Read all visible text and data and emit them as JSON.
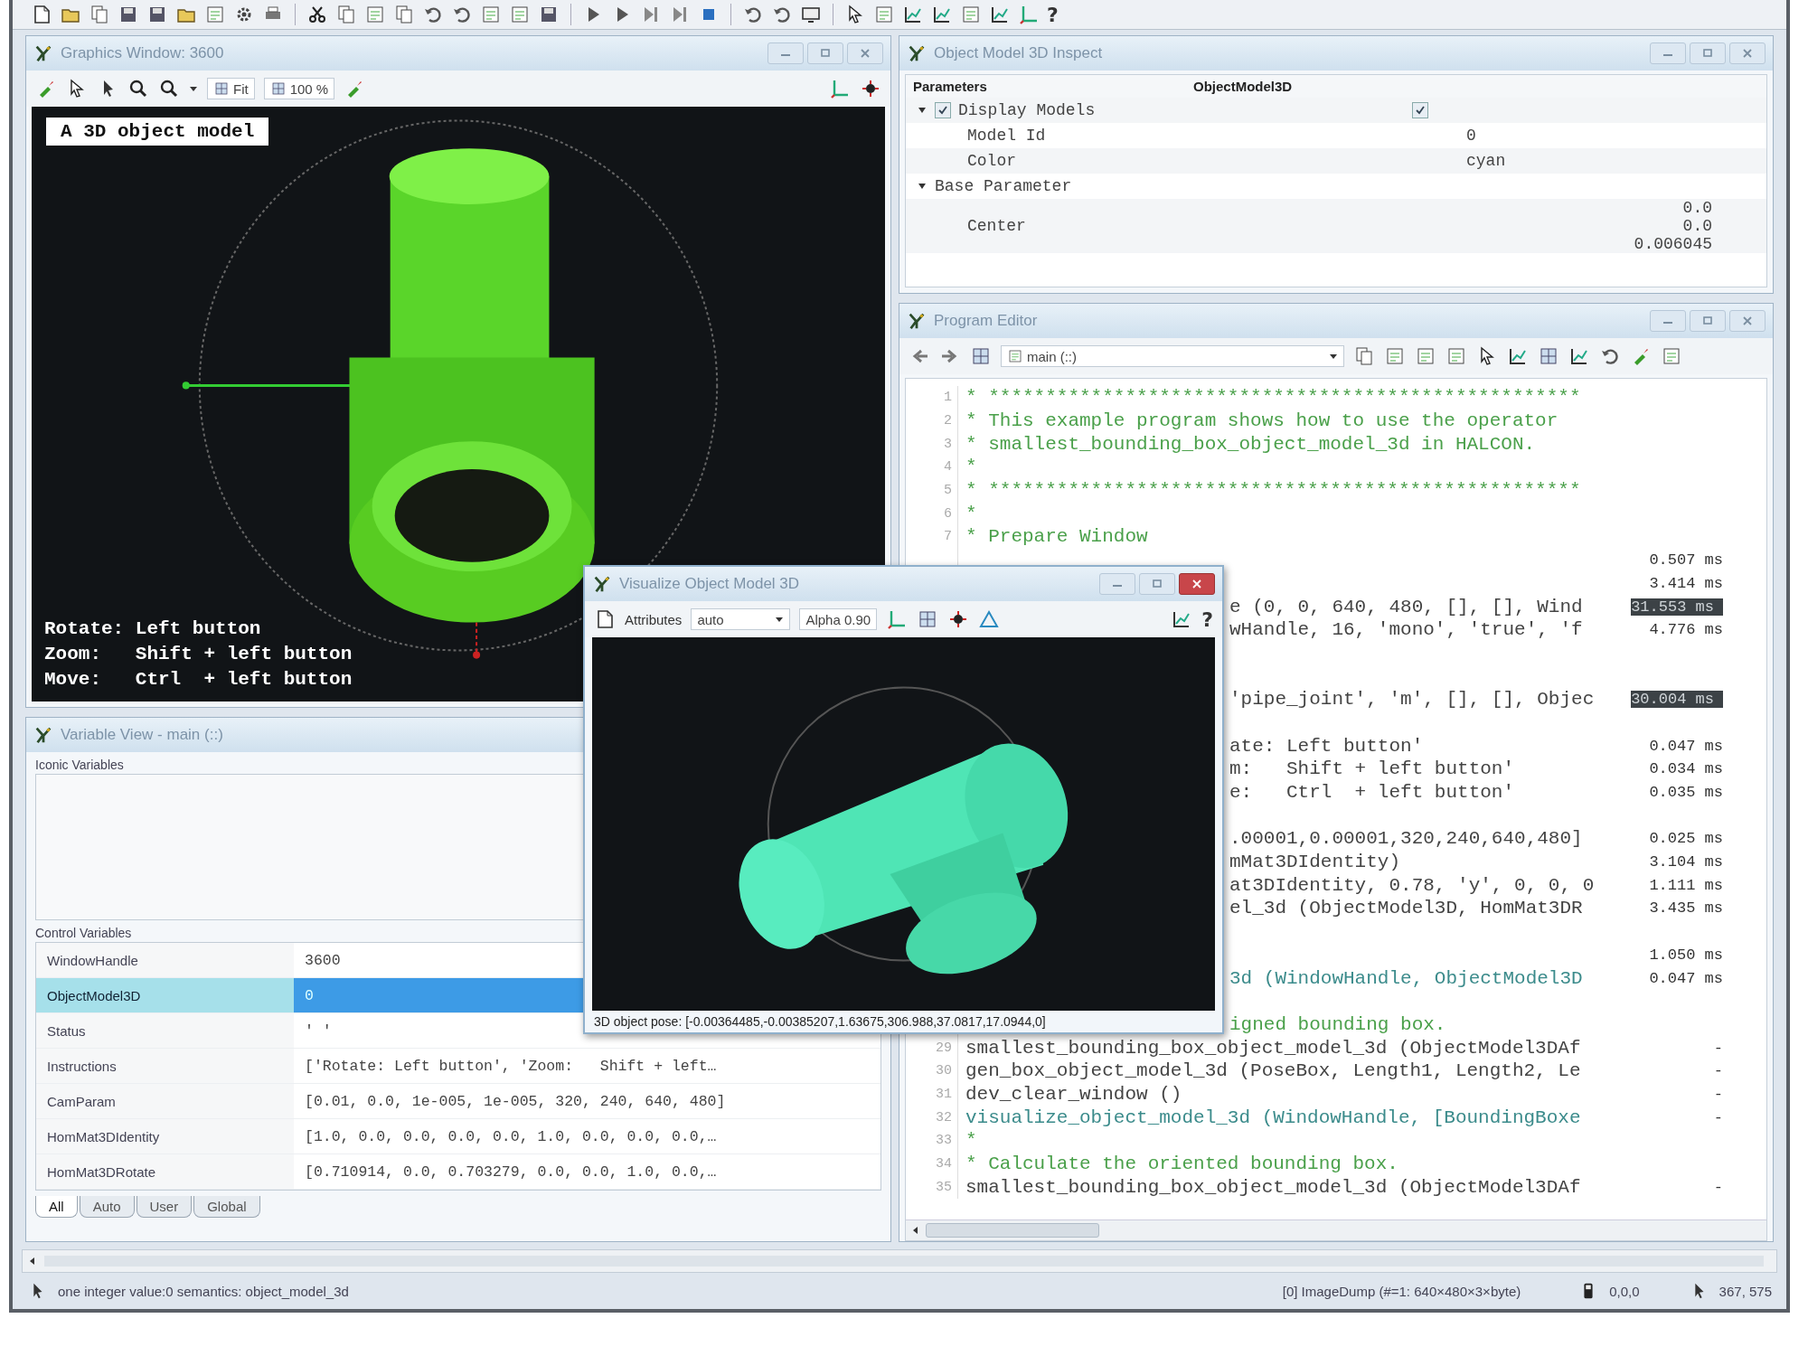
{
  "toolbar": {
    "help": "?"
  },
  "graphics_window": {
    "title": "Graphics Window: 3600",
    "zoom_fit": "Fit",
    "zoom_percent": "100 %",
    "label": "A 3D object model",
    "instructions": [
      "Rotate: Left button",
      "Zoom:   Shift + left button",
      "Move:   Ctrl  + left button"
    ]
  },
  "inspect": {
    "title": "Object Model 3D Inspect",
    "columns": [
      "Parameters",
      "ObjectModel3D"
    ],
    "tree": [
      {
        "label": "Display Models",
        "kind": "check",
        "checked": true,
        "value_checked": true,
        "expanded": true,
        "children": [
          {
            "label": "Model Id",
            "value": "0"
          },
          {
            "label": "Color",
            "value": "cyan"
          }
        ]
      },
      {
        "label": "Base Parameter",
        "kind": "group",
        "expanded": true,
        "children": [
          {
            "label": "Center",
            "values": [
              "0.0",
              "0.0",
              "0.006045"
            ]
          }
        ]
      }
    ]
  },
  "program_editor": {
    "title": "Program Editor",
    "procedure": "main (::)",
    "lines": [
      {
        "number": "1",
        "kind": "comment",
        "text": "* ****************************************************"
      },
      {
        "number": "2",
        "kind": "comment",
        "text": "* This example program shows how to use the operator"
      },
      {
        "number": "3",
        "kind": "comment",
        "text": "* smallest_bounding_box_object_model_3d in HALCON."
      },
      {
        "number": "4",
        "kind": "comment",
        "text": "*"
      },
      {
        "number": "5",
        "kind": "comment",
        "text": "* ****************************************************"
      },
      {
        "number": "6",
        "kind": "comment",
        "text": "*"
      },
      {
        "number": "7",
        "kind": "comment",
        "text": "* Prepare Window"
      },
      {
        "kind": "hidden",
        "time": "0.507 ms"
      },
      {
        "kind": "hidden",
        "time": "3.414 ms"
      },
      {
        "kind": "partial",
        "text": "e (0, 0, 640, 480, [], [], Wind",
        "time": "31.553 ms",
        "highlighted": true
      },
      {
        "kind": "partial",
        "text": "wHandle, 16, 'mono', 'true', 'f",
        "time": "4.776 ms"
      },
      {
        "kind": "hidden"
      },
      {
        "kind": "hidden"
      },
      {
        "kind": "partial",
        "text": "'pipe_joint', 'm', [], [], Objec",
        "time": "30.004 ms",
        "highlighted": true
      },
      {
        "kind": "hidden"
      },
      {
        "kind": "partial",
        "text": "ate: Left button'",
        "time": "0.047 ms"
      },
      {
        "kind": "partial",
        "text": "m:   Shift + left button'",
        "time": "0.034 ms"
      },
      {
        "kind": "partial",
        "text": "e:   Ctrl  + left button'",
        "time": "0.035 ms"
      },
      {
        "kind": "hidden"
      },
      {
        "kind": "partial",
        "text": ".00001,0.00001,320,240,640,480]",
        "time": "0.025 ms"
      },
      {
        "kind": "partial",
        "text": "mMat3DIdentity)",
        "time": "3.104 ms"
      },
      {
        "kind": "partial",
        "text": "at3DIdentity, 0.78, 'y', 0, 0, 0",
        "time": "1.111 ms"
      },
      {
        "kind": "partial",
        "text": "el_3d (ObjectModel3D, HomMat3DR",
        "time": "3.435 ms"
      },
      {
        "kind": "hidden"
      },
      {
        "kind": "hidden",
        "time": "1.050 ms"
      },
      {
        "kind": "partial_procedure",
        "text": "3d (WindowHandle, ObjectModel3D",
        "time": "0.047 ms"
      },
      {
        "kind": "hidden"
      },
      {
        "kind": "partial_comment",
        "text": "igned bounding box."
      },
      {
        "number": "29",
        "kind": "code",
        "text": "smallest_bounding_box_object_model_3d (ObjectModel3DAf",
        "time": "-"
      },
      {
        "number": "30",
        "kind": "code",
        "text": "gen_box_object_model_3d (PoseBox, Length1, Length2, Le",
        "time": "-"
      },
      {
        "number": "31",
        "kind": "code",
        "text": "dev_clear_window ()",
        "time": "-"
      },
      {
        "number": "32",
        "kind": "procedure",
        "text": "visualize_object_model_3d (WindowHandle, [BoundingBoxe",
        "time": "-"
      },
      {
        "number": "33",
        "kind": "comment",
        "text": "*"
      },
      {
        "number": "34",
        "kind": "comment",
        "text": "* Calculate the oriented bounding box."
      },
      {
        "number": "35",
        "kind": "code",
        "text": "smallest_bounding_box_object_model_3d (ObjectModel3DAf",
        "time": "-"
      }
    ]
  },
  "variable_view": {
    "title": "Variable View - main (::)",
    "iconic_label": "Iconic Variables",
    "control_label": "Control Variables",
    "rows": [
      {
        "name": "WindowHandle",
        "value": "3600",
        "selected": false
      },
      {
        "name": "ObjectModel3D",
        "value": "0",
        "selected": true
      },
      {
        "name": "Status",
        "value": "' '",
        "selected": false
      },
      {
        "name": "Instructions",
        "value": "['Rotate: Left button', 'Zoom:   Shift + left…",
        "selected": false
      },
      {
        "name": "CamParam",
        "value": "[0.01, 0.0, 1e-005, 1e-005, 320, 240, 640, 480]",
        "selected": false
      },
      {
        "name": "HomMat3DIdentity",
        "value": "[1.0, 0.0, 0.0, 0.0, 0.0, 1.0, 0.0, 0.0, 0.0,…",
        "selected": false
      },
      {
        "name": "HomMat3DRotate",
        "value": "[0.710914, 0.0, 0.703279, 0.0, 0.0, 1.0, 0.0,…",
        "selected": false
      }
    ],
    "tabs": [
      {
        "label": "All",
        "selected": true
      },
      {
        "label": "Auto",
        "selected": false
      },
      {
        "label": "User",
        "selected": false
      },
      {
        "label": "Global",
        "selected": false
      }
    ]
  },
  "visualize_window": {
    "title": "Visualize Object Model 3D",
    "attributes_label": "Attributes",
    "attributes_value": "auto",
    "alpha": "Alpha 0.90",
    "help": "?",
    "pose": "3D object pose: [-0.00364485,-0.00385207,1.63675,306.988,37.0817,17.0944,0]"
  },
  "status_bar": {
    "message": "one integer value:0 semantics: object_model_3d",
    "image": "[0] ImageDump (#=1: 640×480×3×byte)",
    "pixel_value": "0,0,0",
    "position": "367, 575"
  }
}
